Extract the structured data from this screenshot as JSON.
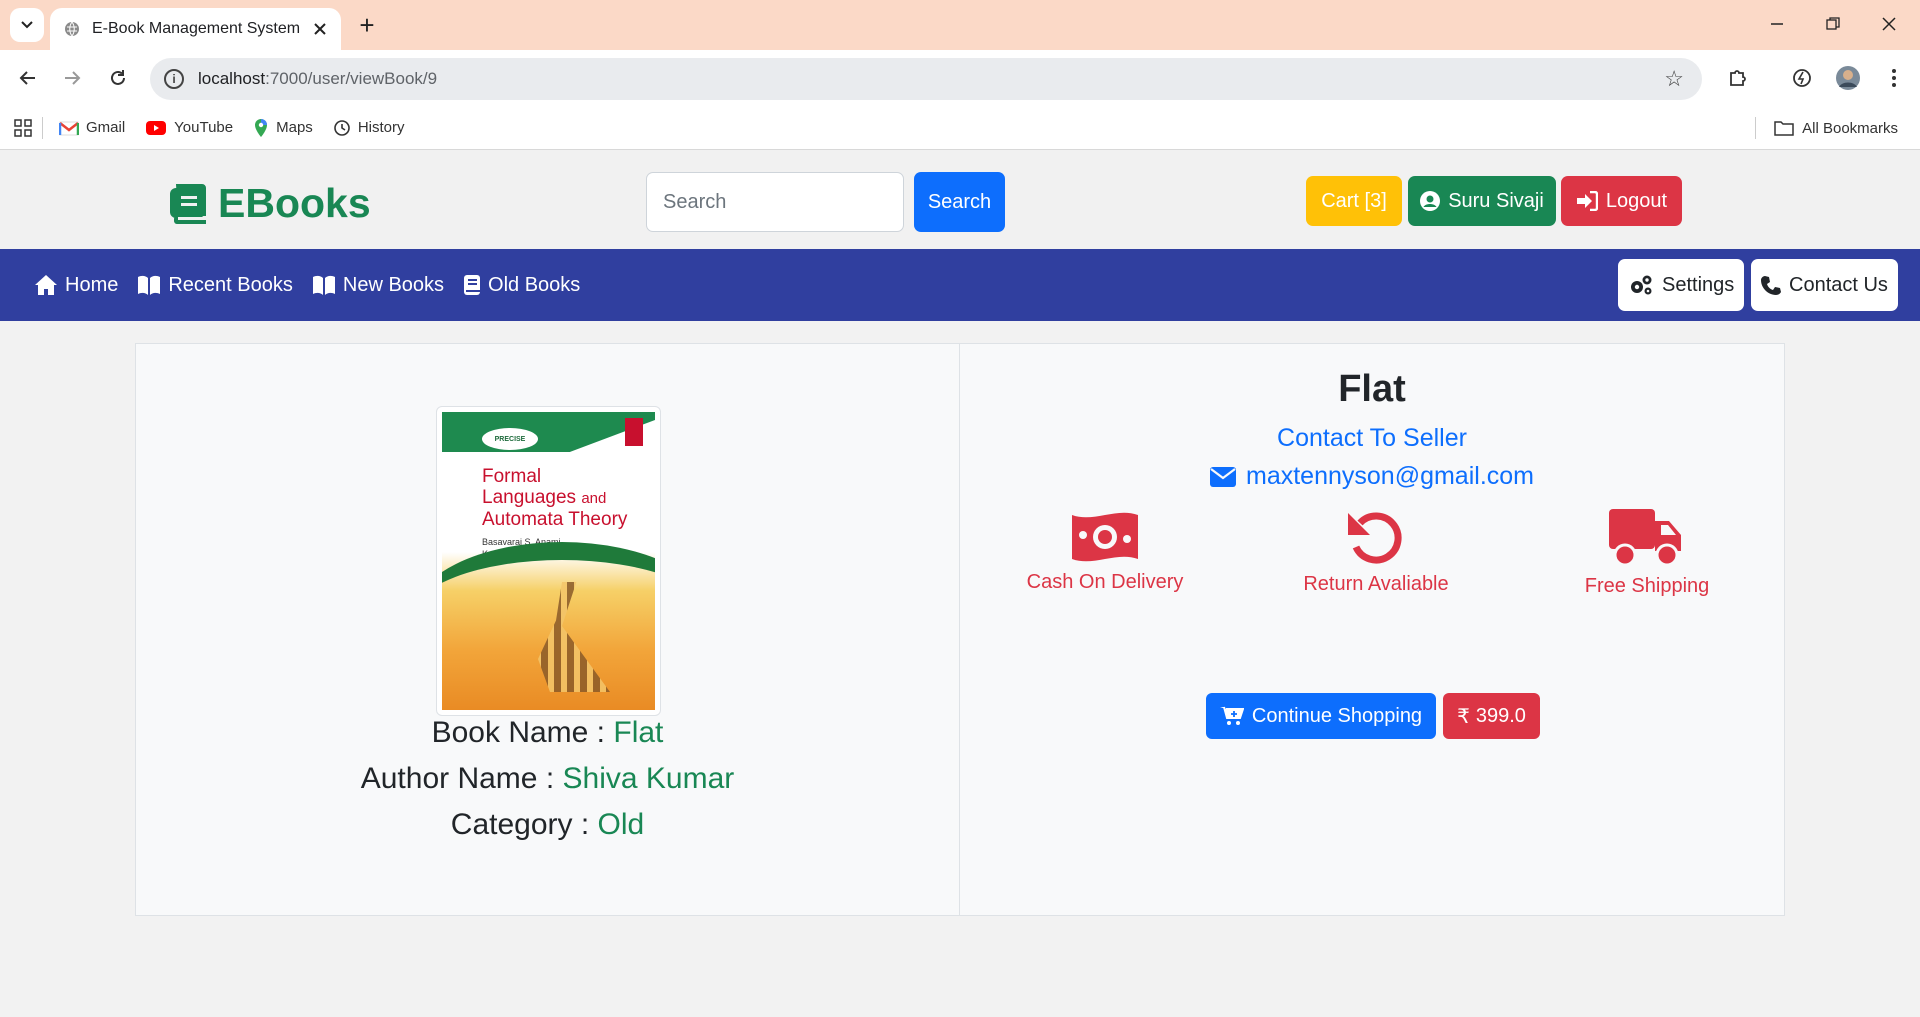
{
  "browser": {
    "tab_title": "E-Book Management System",
    "url_host": "localhost",
    "url_path": ":7000/user/viewBook/9",
    "bookmarks": [
      {
        "label": "Gmail",
        "icon": "gmail-icon"
      },
      {
        "label": "YouTube",
        "icon": "youtube-icon"
      },
      {
        "label": "Maps",
        "icon": "maps-icon"
      },
      {
        "label": "History",
        "icon": "history-icon"
      }
    ],
    "all_bookmarks": "All Bookmarks"
  },
  "header": {
    "logo_text": "EBooks",
    "search_placeholder": "Search",
    "search_button": "Search",
    "cart_label": "Cart [3]",
    "user_label": "Suru Sivaji",
    "logout_label": "Logout"
  },
  "nav": {
    "items": [
      {
        "label": "Home",
        "icon": "home-icon"
      },
      {
        "label": "Recent Books",
        "icon": "book-open-icon"
      },
      {
        "label": "New Books",
        "icon": "book-open-icon"
      },
      {
        "label": "Old Books",
        "icon": "book-icon"
      }
    ],
    "settings_label": "Settings",
    "contact_label": "Contact Us"
  },
  "book": {
    "name_label": "Book Name :",
    "name": "Flat",
    "author_label": "Author Name :",
    "author": "Shiva Kumar",
    "category_label": "Category :",
    "category": "Old",
    "cover": {
      "title": "Formal Languages and Automata Theory",
      "authors": "Basavaraj S. Anami Karibasappa K.G.",
      "publisher": "WILEY PRECISE TEXTBOOK"
    }
  },
  "details": {
    "title": "Flat",
    "contact_seller": "Contact To Seller",
    "email": "maxtennyson@gmail.com",
    "features": [
      {
        "label": "Cash On Delivery",
        "icon": "money-icon"
      },
      {
        "label": "Return Avaliable",
        "icon": "undo-icon"
      },
      {
        "label": "Free Shipping",
        "icon": "truck-icon"
      }
    ],
    "continue_label": "Continue Shopping",
    "price": "399.0"
  },
  "colors": {
    "brand_green": "#198754",
    "primary_blue": "#0d6efd",
    "danger_red": "#dc3545",
    "warning_yellow": "#ffc107",
    "navbar_blue": "#303f9f"
  }
}
